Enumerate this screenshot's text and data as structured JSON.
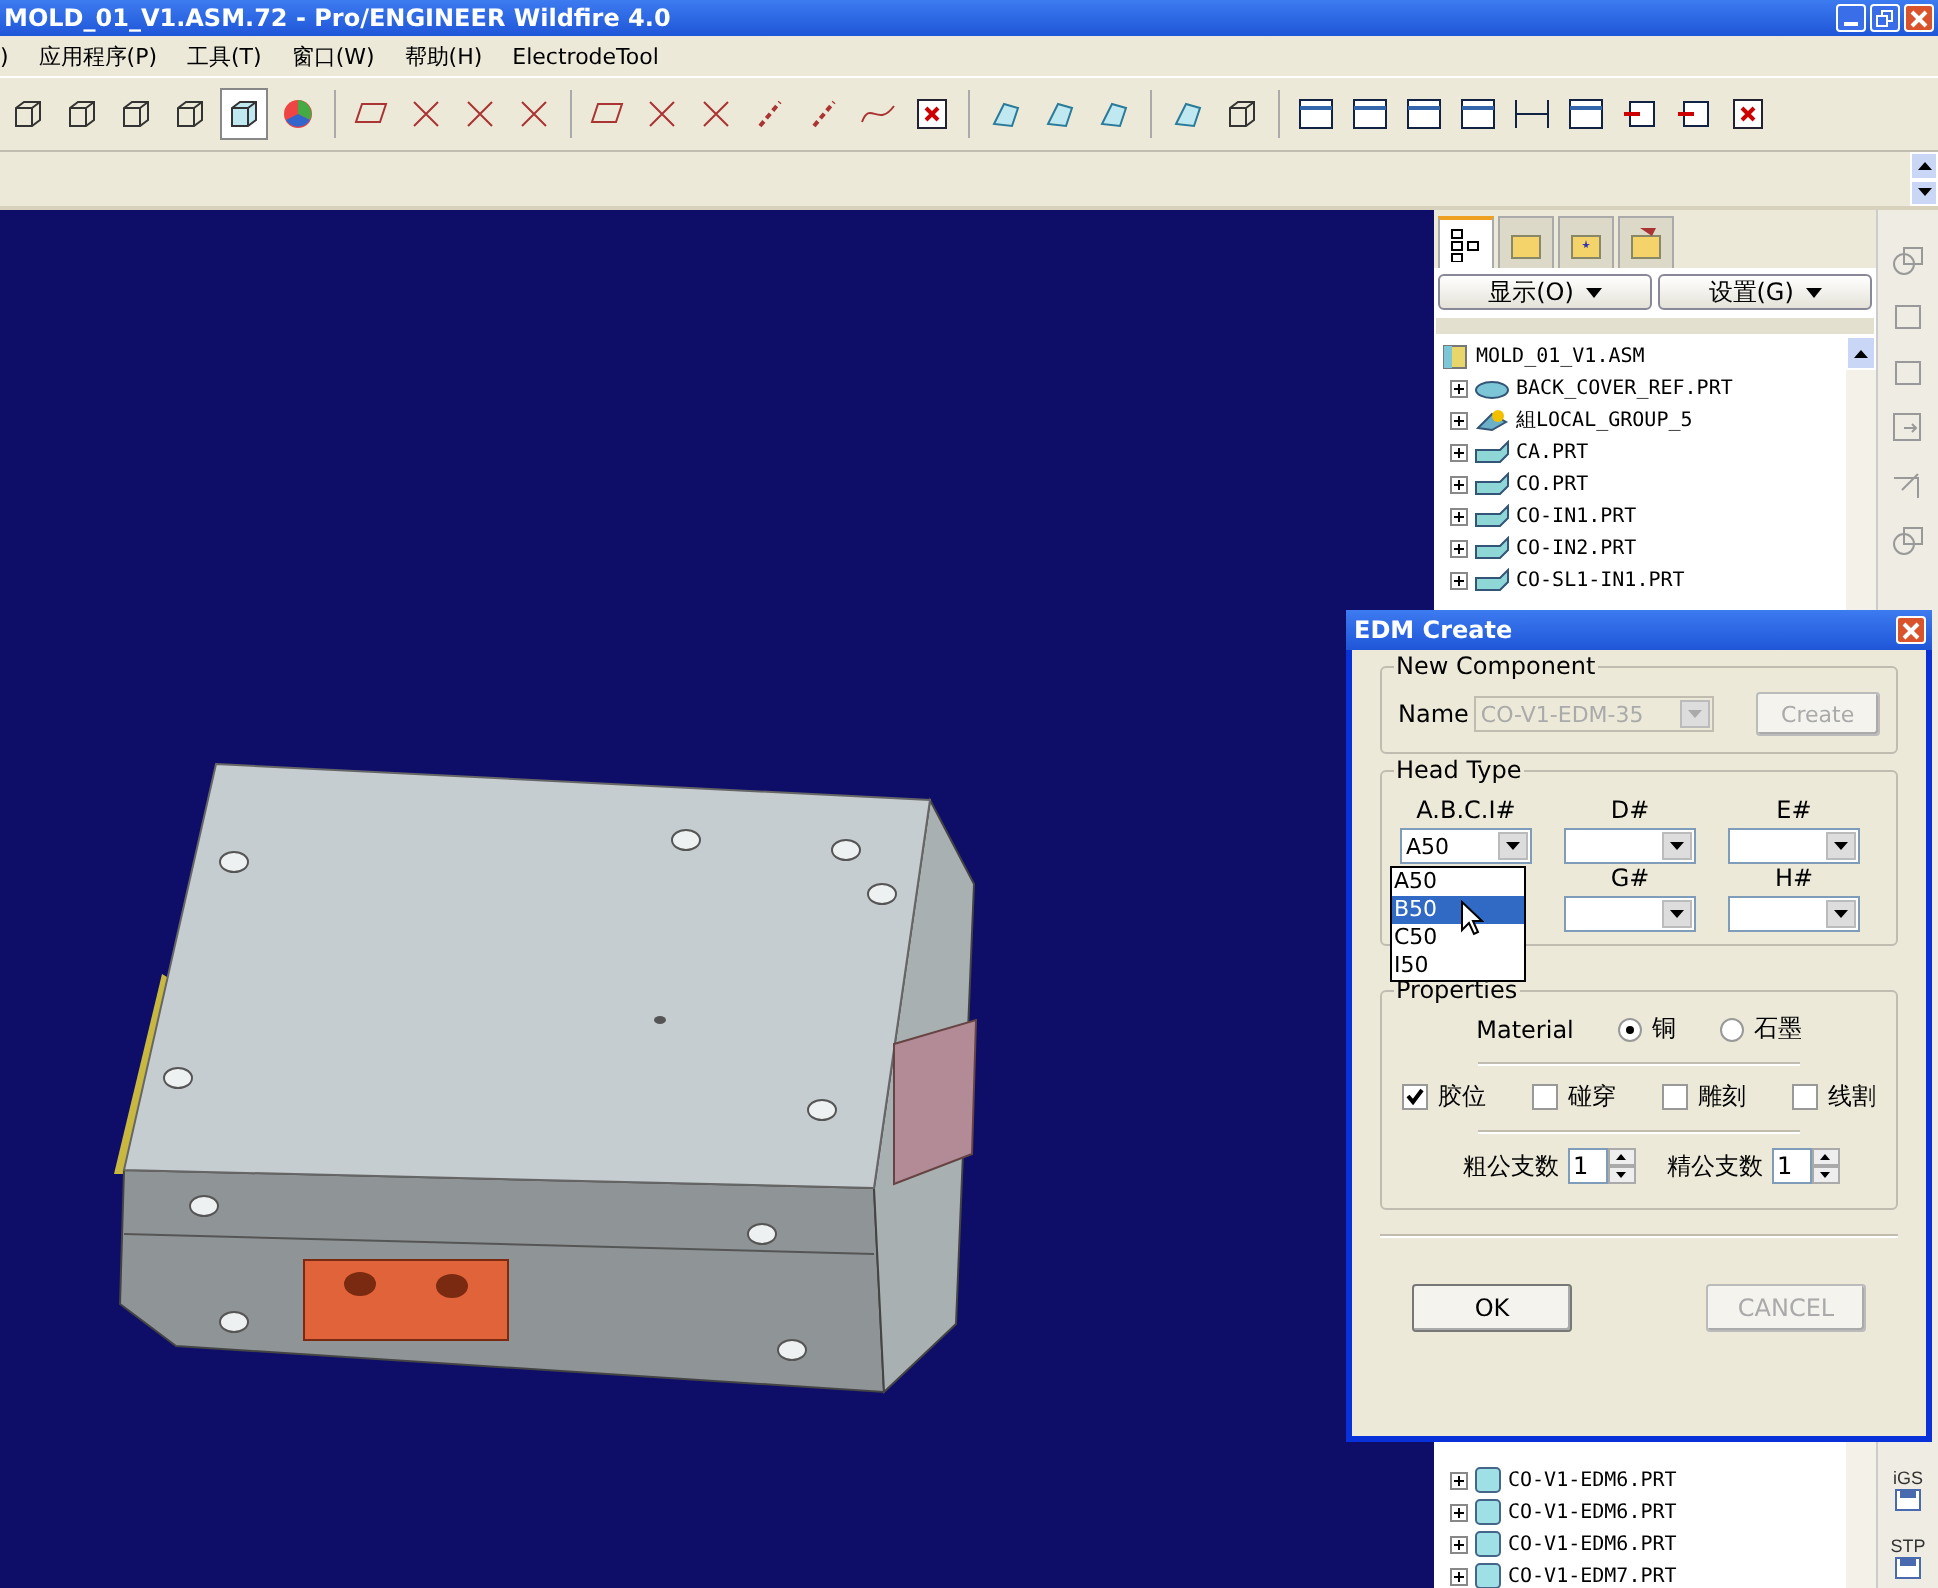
{
  "window": {
    "title": "MOLD_01_V1.ASM.72 - Pro/ENGINEER Wildfire 4.0"
  },
  "menu": [
    ")",
    "应用程序(P)",
    "工具(T)",
    "窗口(W)",
    "帮助(H)",
    "ElectrodeTool"
  ],
  "panel": {
    "tabs": [
      {
        "selected": true
      },
      {
        "selected": false
      },
      {
        "selected": false
      },
      {
        "selected": false
      }
    ],
    "buttons": [
      "显示(O)",
      "设置(G)"
    ]
  },
  "model_tree": {
    "root": "MOLD_01_V1.ASM",
    "items": [
      {
        "label": "BACK_COVER_REF.PRT",
        "kind": "surface"
      },
      {
        "label": "組LOCAL_GROUP_5",
        "kind": "group"
      },
      {
        "label": "CA.PRT",
        "kind": "part"
      },
      {
        "label": "CO.PRT",
        "kind": "part"
      },
      {
        "label": "CO-IN1.PRT",
        "kind": "part"
      },
      {
        "label": "CO-IN2.PRT",
        "kind": "part"
      },
      {
        "label": "CO-SL1-IN1.PRT",
        "kind": "part"
      }
    ],
    "items_below_dialog": [
      {
        "label": "CO-V1-EDM6.PRT",
        "kind": "electrode"
      },
      {
        "label": "CO-V1-EDM6.PRT",
        "kind": "electrode"
      },
      {
        "label": "CO-V1-EDM6.PRT",
        "kind": "electrode"
      },
      {
        "label": "CO-V1-EDM7.PRT",
        "kind": "electrode"
      }
    ]
  },
  "side_toolbar": {
    "export_labels": [
      "iGS",
      "STP"
    ]
  },
  "dialog": {
    "title": "EDM Create",
    "new_component": {
      "legend": "New Component",
      "name_label": "Name",
      "name_value": "CO-V1-EDM-35",
      "name_disabled": true,
      "create_button": "Create",
      "create_disabled": true
    },
    "head_type": {
      "legend": "Head Type",
      "fields": [
        {
          "label": "A.B.C.I#",
          "value": "A50"
        },
        {
          "label": "D#"
        },
        {
          "label": "E#"
        }
      ],
      "fields_second_row": [
        {
          "label": "G#"
        },
        {
          "label": "H#"
        }
      ],
      "open_list": [
        {
          "label": "A50",
          "selected": false
        },
        {
          "label": "B50",
          "selected": true
        },
        {
          "label": "C50",
          "selected": false
        },
        {
          "label": "I50",
          "selected": false
        }
      ]
    },
    "properties": {
      "legend": "Properties",
      "material_label": "Material",
      "materials": [
        {
          "label": "铜",
          "selected": true
        },
        {
          "label": "石墨",
          "selected": false
        }
      ],
      "options": [
        {
          "label": "胶位",
          "checked": true
        },
        {
          "label": "碰穿",
          "checked": false
        },
        {
          "label": "雕刻",
          "checked": false
        },
        {
          "label": "线割",
          "checked": false
        }
      ],
      "counts": [
        {
          "label": "粗公支数",
          "value": "1"
        },
        {
          "label": "精公支数",
          "value": "1"
        }
      ]
    },
    "buttons": [
      {
        "label": "OK",
        "disabled": false
      },
      {
        "label": "CANCEL",
        "disabled": true
      }
    ]
  }
}
